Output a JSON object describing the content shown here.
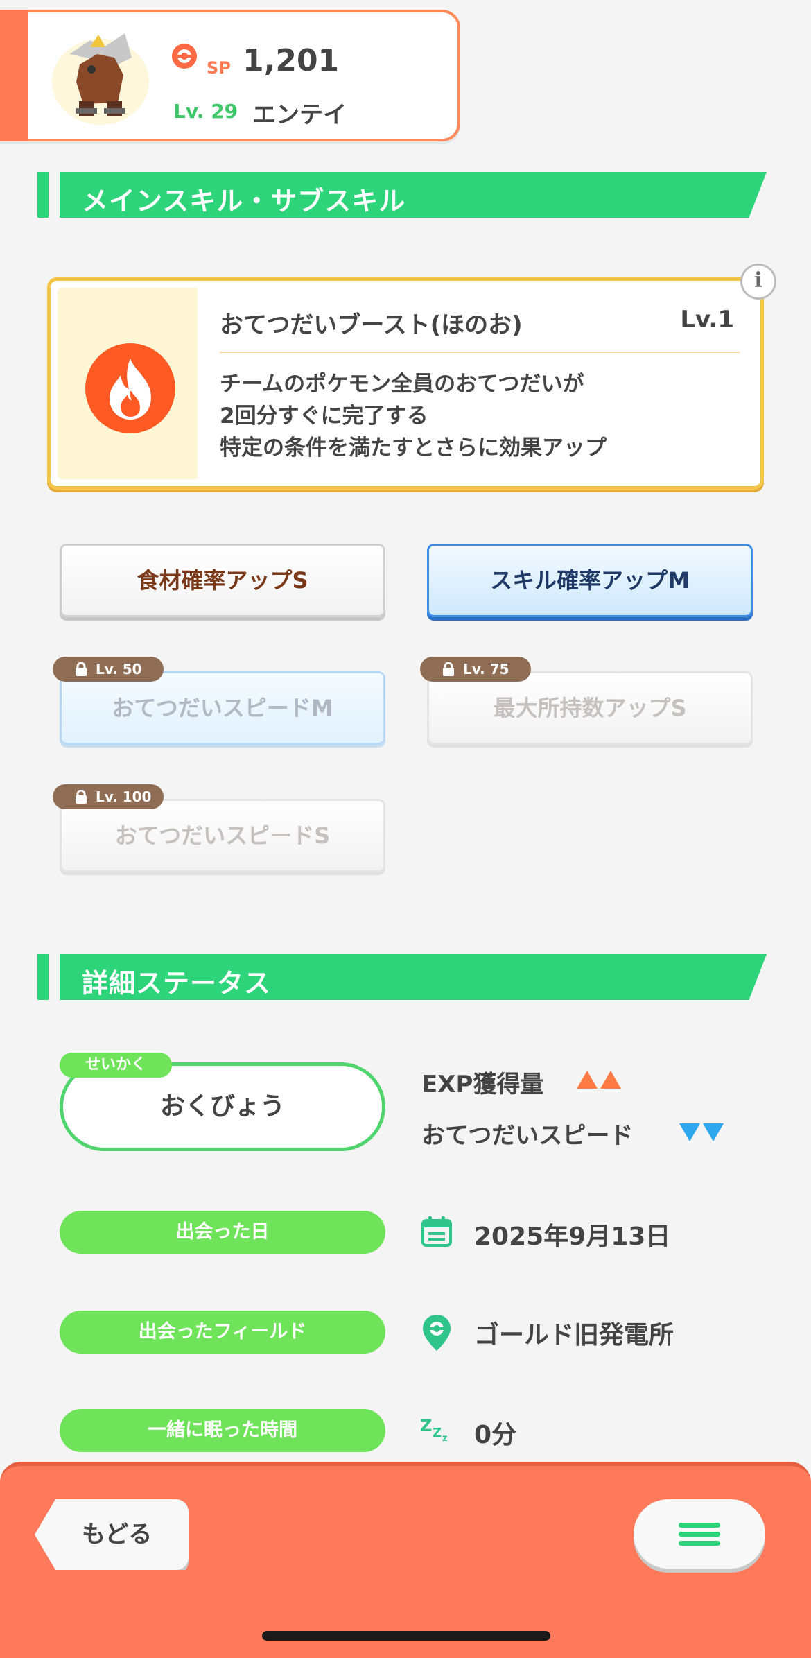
{
  "header": {
    "sp_label": "SP",
    "sp_value": "1,201",
    "level_label": "Lv. 29",
    "pokemon_name": "エンテイ",
    "accent_color": "#ff7a55"
  },
  "sections": {
    "skills_title": "メインスキル・サブスキル",
    "details_title": "詳細ステータス"
  },
  "main_skill": {
    "name": "おてつだいブースト(ほのお)",
    "level": "Lv.1",
    "description_lines": [
      "チームのポケモン全員のおてつだいが",
      "2回分すぐに完了する",
      "特定の条件を満たすとさらに効果アップ"
    ],
    "icon": "fire-icon",
    "info_label": "i"
  },
  "sub_skills": [
    {
      "label": "食材確率アップS",
      "lock": "",
      "state": "unlocked-gold"
    },
    {
      "label": "スキル確率アップM",
      "lock": "",
      "state": "unlocked-blue"
    },
    {
      "label": "おてつだいスピードM",
      "lock": "Lv. 50",
      "state": "locked-blue"
    },
    {
      "label": "最大所持数アップS",
      "lock": "Lv. 75",
      "state": "locked"
    },
    {
      "label": "おてつだいスピードS",
      "lock": "Lv. 100",
      "state": "locked"
    }
  ],
  "nature": {
    "tag": "せいかく",
    "value": "おくびょう",
    "up_stat": "EXP獲得量",
    "down_stat": "おてつだいスピード",
    "up_color": "#ff7a45",
    "down_color": "#2fa8f0"
  },
  "details": {
    "met_date_label": "出会った日",
    "met_date_value": "2025年9月13日",
    "met_field_label": "出会ったフィールド",
    "met_field_value": "ゴールド旧発電所",
    "slept_label": "一緒に眠った時間",
    "slept_value": "0分"
  },
  "bottom_bar": {
    "back_label": "もどる",
    "menu_icon": "hamburger-menu-icon"
  }
}
